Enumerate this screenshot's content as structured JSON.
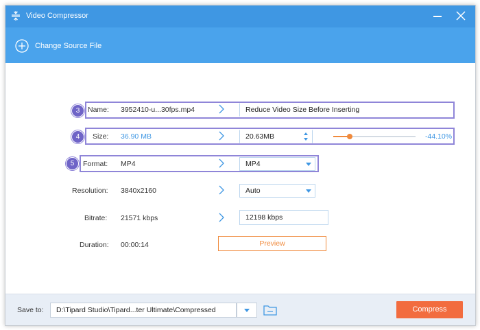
{
  "window": {
    "title": "Video Compressor"
  },
  "toolbar": {
    "change_source_label": "Change Source File"
  },
  "badges": {
    "name": "3",
    "size": "4",
    "format": "5"
  },
  "rows": {
    "name": {
      "label": "Name:",
      "source": "3952410-u...30fps.mp4",
      "output": "Reduce Video  Size Before Inserting"
    },
    "size": {
      "label": "Size:",
      "source": "36.90 MB",
      "output": "20.63MB",
      "slider_fraction": 0.2,
      "percent": "-44.10%"
    },
    "format": {
      "label": "Format:",
      "source": "MP4",
      "output": "MP4"
    },
    "resolution": {
      "label": "Resolution:",
      "source": "3840x2160",
      "output": "Auto"
    },
    "bitrate": {
      "label": "Bitrate:",
      "source": "21571 kbps",
      "output": "12198 kbps"
    },
    "duration": {
      "label": "Duration:",
      "source": "00:00:14"
    }
  },
  "preview": {
    "label": "Preview"
  },
  "bottom": {
    "save_to_label": "Save to:",
    "save_path": "D:\\Tipard Studio\\Tipard...ter Ultimate\\Compressed",
    "compress_label": "Compress"
  },
  "colors": {
    "title_bar": "#3f97e3",
    "toolbar": "#4aa3ec",
    "accent_orange": "#f26c3f",
    "highlight": "#8f85d8"
  }
}
